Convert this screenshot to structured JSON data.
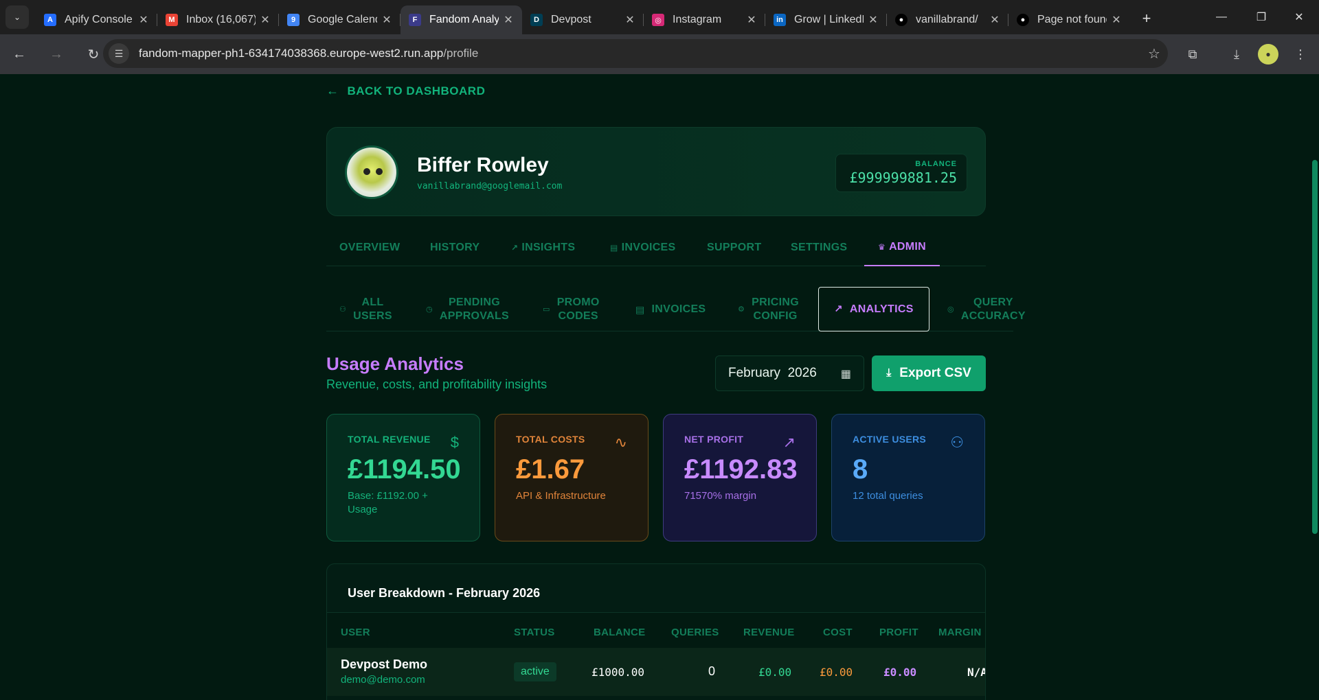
{
  "browser": {
    "tabs": [
      {
        "title": "Apify Console",
        "favicon": "apify-icon",
        "color": "#246dff"
      },
      {
        "title": "Inbox (16,067)",
        "favicon": "gmail-icon",
        "color": "#ea4335"
      },
      {
        "title": "Google Calendar",
        "favicon": "calendar-icon",
        "color": "#4285f4"
      },
      {
        "title": "Fandom Analytics",
        "favicon": "fandom-icon",
        "color": "#3b3b8a"
      },
      {
        "title": "Devpost",
        "favicon": "devpost-icon",
        "color": "#003e54"
      },
      {
        "title": "Instagram",
        "favicon": "instagram-icon",
        "color": "#d62976"
      },
      {
        "title": "Grow | LinkedIn",
        "favicon": "linkedin-icon",
        "color": "#0a66c2"
      },
      {
        "title": "vanillabrand/",
        "favicon": "github-icon",
        "color": "#222222"
      },
      {
        "title": "Page not found",
        "favicon": "github-icon",
        "color": "#222222"
      }
    ],
    "url_host": "fandom-mapper-ph1-634174038368.europe-west2.run.app",
    "url_path": "/profile"
  },
  "nav": {
    "back_label": "BACK TO DASHBOARD"
  },
  "profile": {
    "name": "Biffer Rowley",
    "email": "vanillabrand@googlemail.com",
    "balance_label": "BALANCE",
    "balance_value": "£999999881.25"
  },
  "main_tabs": [
    "OVERVIEW",
    "HISTORY",
    "INSIGHTS",
    "INVOICES",
    "SUPPORT",
    "SETTINGS",
    "ADMIN"
  ],
  "sub_tabs": {
    "all_users": [
      "ALL",
      "USERS"
    ],
    "pending": [
      "PENDING",
      "APPROVALS"
    ],
    "promo": [
      "PROMO",
      "CODES"
    ],
    "invoices": "INVOICES",
    "pricing": [
      "PRICING",
      "CONFIG"
    ],
    "analytics": "ANALYTICS",
    "query": [
      "QUERY",
      "ACCURACY"
    ]
  },
  "analytics": {
    "title": "Usage Analytics",
    "subtitle": "Revenue, costs, and profitability insights",
    "month": "February  2026",
    "export_label": "Export CSV"
  },
  "stats": {
    "revenue": {
      "label": "TOTAL REVENUE",
      "value": "£1194.50",
      "note": "Base: £1192.00 + Usage"
    },
    "costs": {
      "label": "TOTAL COSTS",
      "value": "£1.67",
      "note": "API & Infrastructure"
    },
    "profit": {
      "label": "NET PROFIT",
      "value": "£1192.83",
      "note": "71570% margin"
    },
    "users": {
      "label": "ACTIVE USERS",
      "value": "8",
      "note": "12 total queries"
    }
  },
  "breakdown": {
    "title": "User Breakdown - February 2026",
    "headers": [
      "USER",
      "STATUS",
      "BALANCE",
      "QUERIES",
      "REVENUE",
      "COST",
      "PROFIT",
      "MARGIN"
    ],
    "rows": [
      {
        "name": "Devpost Demo",
        "email": "demo@demo.com",
        "status": "active",
        "balance": "£1000.00",
        "queries": "0",
        "revenue": "£0.00",
        "cost": "£0.00",
        "profit": "£0.00",
        "margin": "N/A"
      }
    ]
  }
}
